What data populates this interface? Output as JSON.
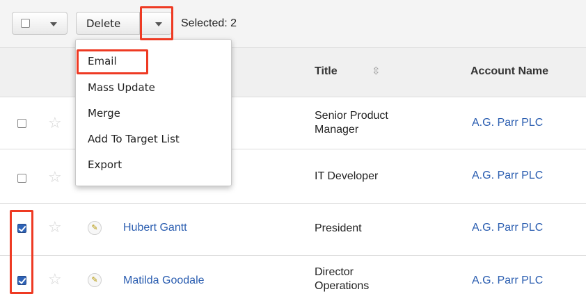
{
  "toolbar": {
    "delete_label": "Delete",
    "selected_text": "Selected: 2"
  },
  "actions_menu": {
    "items": [
      {
        "label": "Email",
        "highlighted": true
      },
      {
        "label": "Mass Update"
      },
      {
        "label": "Merge"
      },
      {
        "label": "Add To Target List"
      },
      {
        "label": "Export"
      }
    ]
  },
  "table": {
    "columns": [
      "Title",
      "Account Name"
    ],
    "rows": [
      {
        "checked": false,
        "name": "",
        "title": [
          "Senior Product",
          "Manager"
        ],
        "account": "A.G. Parr PLC"
      },
      {
        "checked": false,
        "name": "",
        "title": [
          "IT Developer"
        ],
        "account": "A.G. Parr PLC"
      },
      {
        "checked": true,
        "name": "Hubert Gantt",
        "title": [
          "President"
        ],
        "account": "A.G. Parr PLC"
      },
      {
        "checked": true,
        "name": "Matilda Goodale",
        "title": [
          "Director",
          "Operations"
        ],
        "account": "A.G. Parr PLC"
      }
    ]
  },
  "icons": {
    "star": "star-icon",
    "edit": "pencil-icon",
    "sort": "sort-icon",
    "caret": "chevron-down-icon"
  },
  "colors": {
    "highlight": "#ee3a23",
    "link": "#2a5db0",
    "checkbox_checked": "#2f63b6"
  }
}
